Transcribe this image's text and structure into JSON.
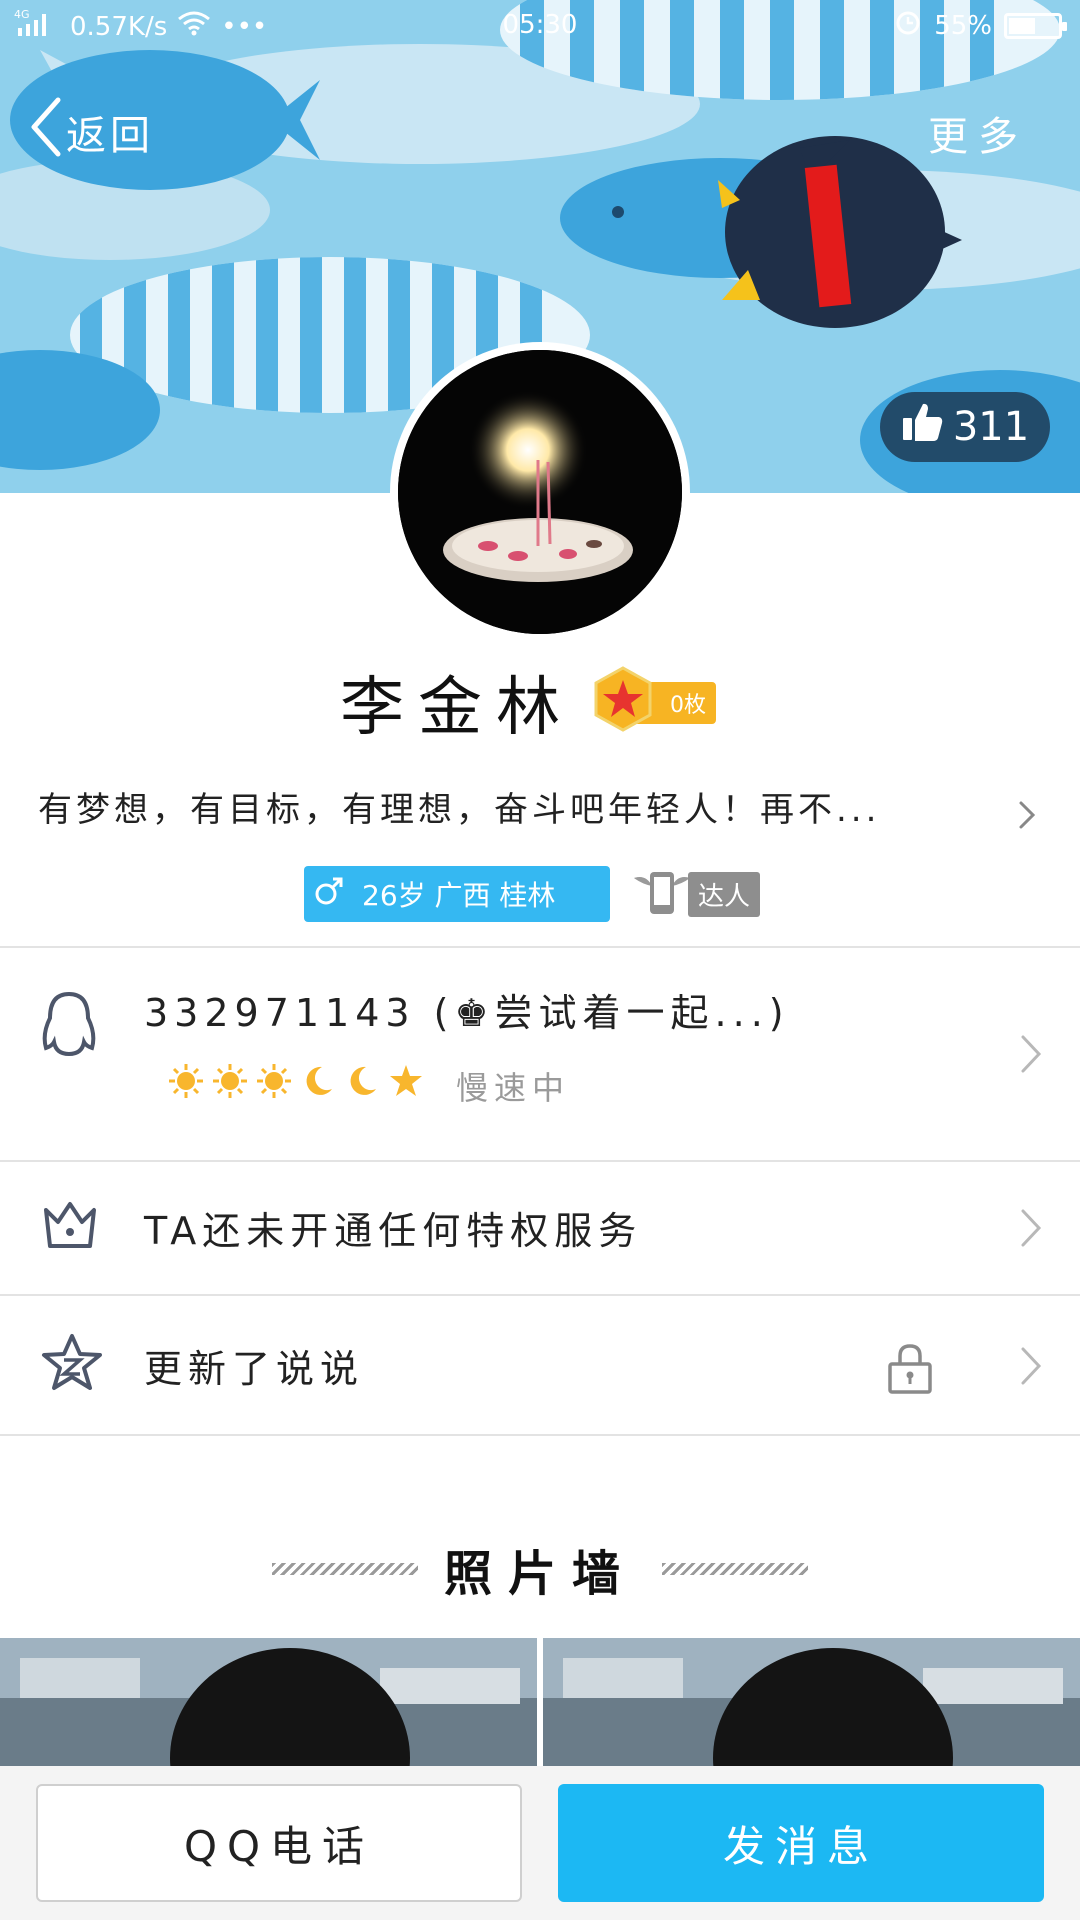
{
  "status_bar": {
    "network": "4G",
    "speed": "0.57K/s",
    "time": "05:30",
    "battery": "55%",
    "battery_level": 0.55
  },
  "header": {
    "back_label": "返回",
    "more_label": "更多",
    "like_count": "311"
  },
  "profile": {
    "name": "李金林",
    "badge_label": "0枚",
    "signature": "有梦想，有目标，有理想，奋斗吧年轻人！再不...",
    "info_tag": "26岁  广西  桂林",
    "daren_label": "达人"
  },
  "rows": {
    "qq": {
      "text": "332971143 (♚尝试着一起...)",
      "status": "慢速中"
    },
    "vip": {
      "text": "TA还未开通任何特权服务"
    },
    "qzone": {
      "text": "更新了说说"
    }
  },
  "photo_wall": {
    "title": "照片墙"
  },
  "actions": {
    "call_label": "QQ电话",
    "message_label": "发消息"
  },
  "colors": {
    "accent": "#1cb8f3",
    "badge": "#f7b423",
    "banner": "#8fd0ec"
  }
}
